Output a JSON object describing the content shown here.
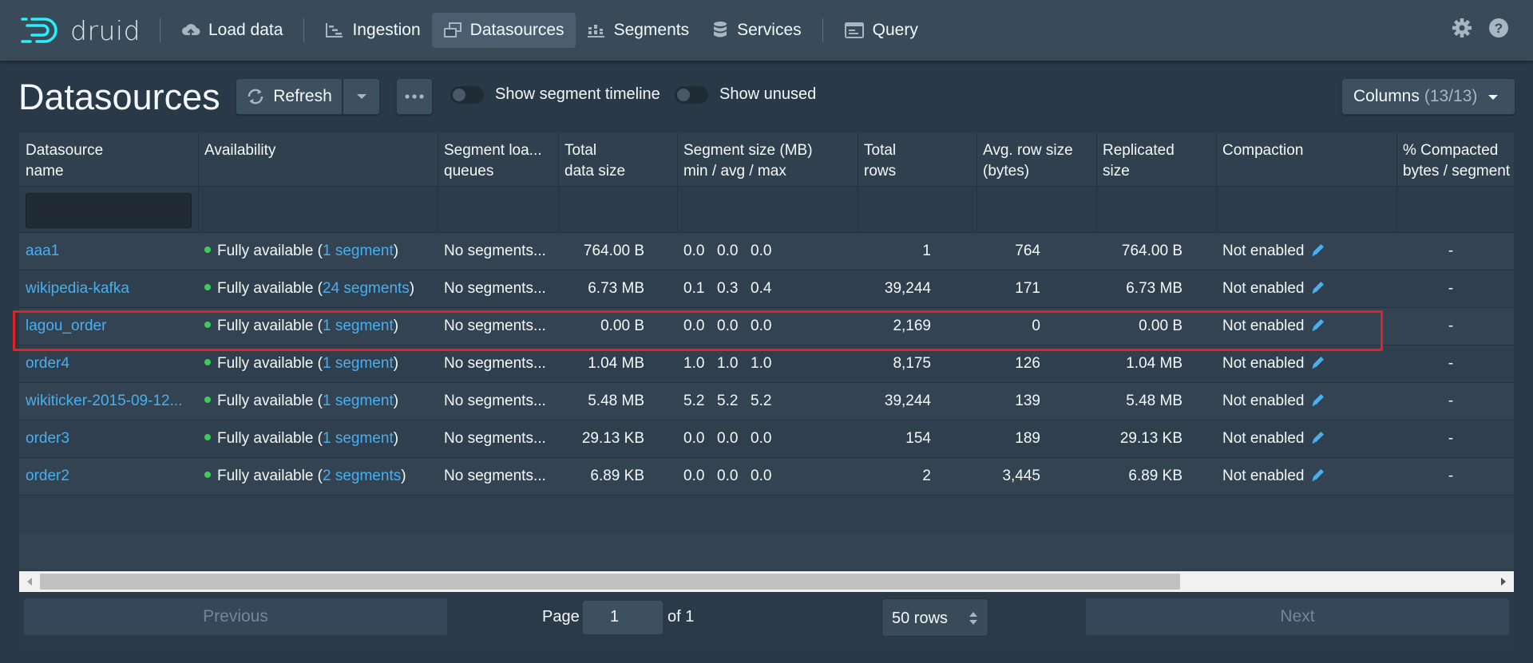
{
  "app": {
    "logo_text": "druid"
  },
  "nav": {
    "load_data": "Load data",
    "ingestion": "Ingestion",
    "datasources": "Datasources",
    "segments": "Segments",
    "services": "Services",
    "query": "Query"
  },
  "page": {
    "title": "Datasources",
    "refresh_label": "Refresh",
    "toggle_timeline": "Show segment timeline",
    "toggle_unused": "Show unused",
    "columns_label": "Columns",
    "columns_count": "(13/13)"
  },
  "headers": {
    "name": "Datasource\nname",
    "availability": "Availability",
    "queues": "Segment loa...\nqueues",
    "total_size": "Total\ndata size",
    "seg_size": "Segment size (MB)\nmin / avg / max",
    "total_rows": "Total\nrows",
    "avg_row": "Avg. row size\n(bytes)",
    "replicated": "Replicated\nsize",
    "compaction": "Compaction",
    "compacted": "% Compacted\nbytes / segment"
  },
  "rows": [
    {
      "name": "aaa1",
      "avail_prefix": "Fully available (",
      "avail_link": "1 segment",
      "avail_suffix": ")",
      "queues": "No segments...",
      "total_size": "764.00 B",
      "min": "0.0",
      "avg": "0.0",
      "max": "0.0",
      "total_rows": "1",
      "avg_row": "764",
      "replicated": "764.00 B",
      "compaction": "Not enabled",
      "compacted": "-"
    },
    {
      "name": "wikipedia-kafka",
      "avail_prefix": "Fully available (",
      "avail_link": "24 segments",
      "avail_suffix": ")",
      "queues": "No segments...",
      "total_size": "6.73 MB",
      "min": "0.1",
      "avg": "0.3",
      "max": "0.4",
      "total_rows": "39,244",
      "avg_row": "171",
      "replicated": "6.73 MB",
      "compaction": "Not enabled",
      "compacted": "-"
    },
    {
      "name": "lagou_order",
      "avail_prefix": "Fully available (",
      "avail_link": "1 segment",
      "avail_suffix": ")",
      "queues": "No segments...",
      "total_size": "0.00 B",
      "min": "0.0",
      "avg": "0.0",
      "max": "0.0",
      "total_rows": "2,169",
      "avg_row": "0",
      "replicated": "0.00 B",
      "compaction": "Not enabled",
      "compacted": "-"
    },
    {
      "name": "order4",
      "avail_prefix": "Fully available (",
      "avail_link": "1 segment",
      "avail_suffix": ")",
      "queues": "No segments...",
      "total_size": "1.04 MB",
      "min": "1.0",
      "avg": "1.0",
      "max": "1.0",
      "total_rows": "8,175",
      "avg_row": "126",
      "replicated": "1.04 MB",
      "compaction": "Not enabled",
      "compacted": "-"
    },
    {
      "name": "wikiticker-2015-09-12...",
      "avail_prefix": "Fully available (",
      "avail_link": "1 segment",
      "avail_suffix": ")",
      "queues": "No segments...",
      "total_size": "5.48 MB",
      "min": "5.2",
      "avg": "5.2",
      "max": "5.2",
      "total_rows": "39,244",
      "avg_row": "139",
      "replicated": "5.48 MB",
      "compaction": "Not enabled",
      "compacted": "-"
    },
    {
      "name": "order3",
      "avail_prefix": "Fully available (",
      "avail_link": "1 segment",
      "avail_suffix": ")",
      "queues": "No segments...",
      "total_size": "29.13 KB",
      "min": "0.0",
      "avg": "0.0",
      "max": "0.0",
      "total_rows": "154",
      "avg_row": "189",
      "replicated": "29.13 KB",
      "compaction": "Not enabled",
      "compacted": "-"
    },
    {
      "name": "order2",
      "avail_prefix": "Fully available (",
      "avail_link": "2 segments",
      "avail_suffix": ")",
      "queues": "No segments...",
      "total_size": "6.89 KB",
      "min": "0.0",
      "avg": "0.0",
      "max": "0.0",
      "total_rows": "2",
      "avg_row": "3,445",
      "replicated": "6.89 KB",
      "compaction": "Not enabled",
      "compacted": "-"
    }
  ],
  "pager": {
    "previous": "Previous",
    "page_label": "Page",
    "page_value": "1",
    "of_label": "of 1",
    "rows_option": "50 rows",
    "next": "Next"
  }
}
